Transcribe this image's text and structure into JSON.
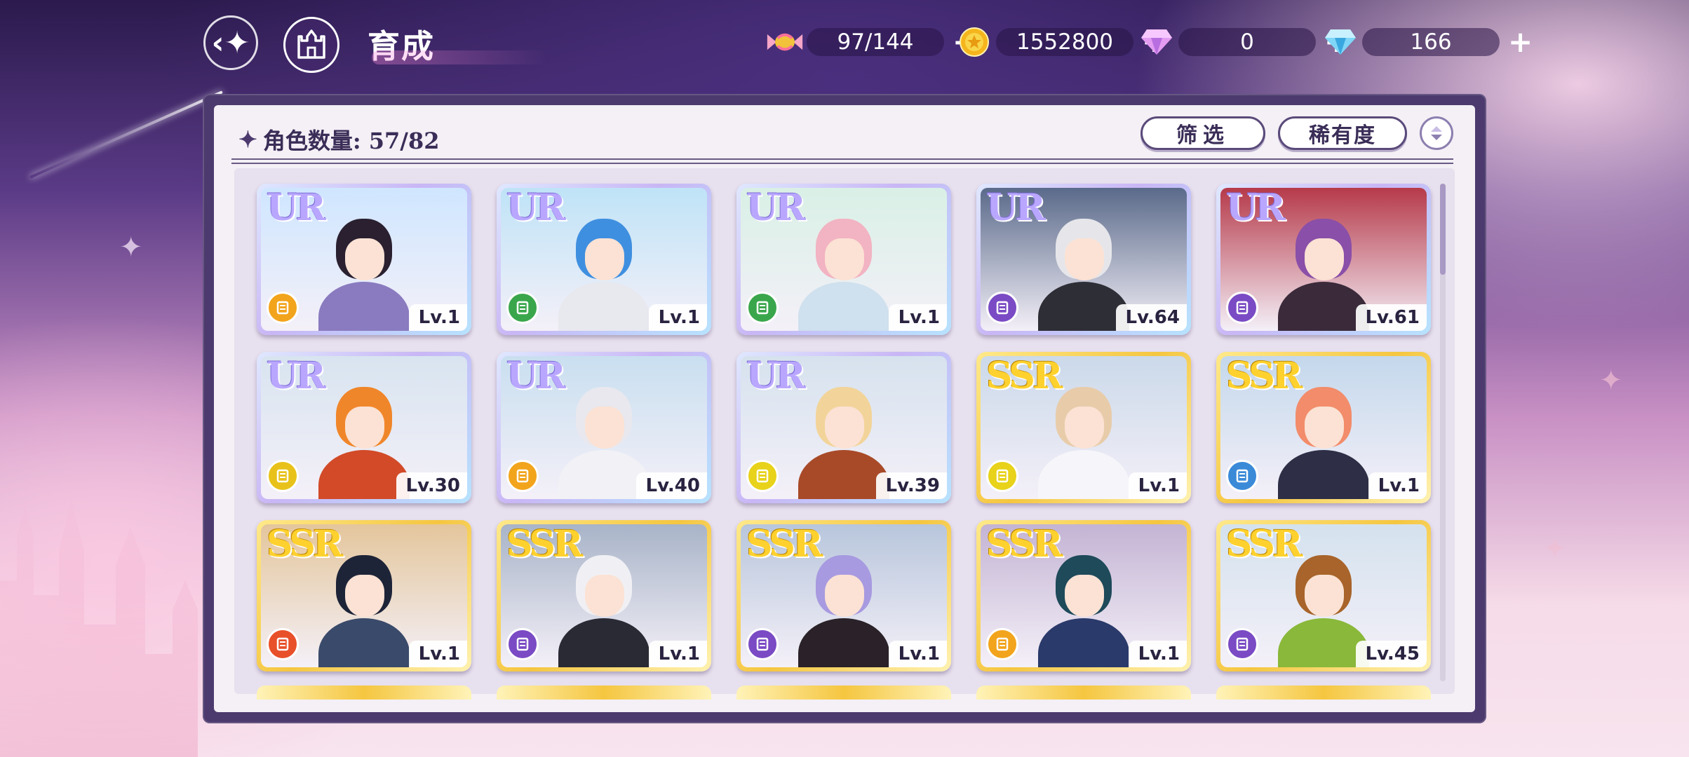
{
  "header": {
    "title": "育成",
    "currencies": [
      {
        "icon": "candy-icon",
        "value": "97/144"
      },
      {
        "icon": "gold-coin-icon",
        "value": "1552800"
      },
      {
        "icon": "pink-gem-icon",
        "value": "0"
      },
      {
        "icon": "blue-diamond-icon",
        "value": "166"
      }
    ]
  },
  "panel": {
    "count_label": "角色数量: 57/82",
    "filter_label": "筛选",
    "sort_label": "稀有度"
  },
  "cards": [
    {
      "rarity": "UR",
      "level": "Lv.1",
      "class_color": "#f2a41c",
      "hair": "#2a2030",
      "outfit": "#8a7bc0",
      "bg": "#cfe6ff"
    },
    {
      "rarity": "UR",
      "level": "Lv.1",
      "class_color": "#3aa64c",
      "hair": "#3f8fe0",
      "outfit": "#e8e8ef",
      "bg": "#bfe3f7"
    },
    {
      "rarity": "UR",
      "level": "Lv.1",
      "class_color": "#3aa64c",
      "hair": "#f2b3c2",
      "outfit": "#cfe0ee",
      "bg": "#d9f0e6"
    },
    {
      "rarity": "UR",
      "level": "Lv.64",
      "class_color": "#7a4bc4",
      "hair": "#e6e6ea",
      "outfit": "#2e2e36",
      "bg": "#5a6a8a"
    },
    {
      "rarity": "UR",
      "level": "Lv.61",
      "class_color": "#7a4bc4",
      "hair": "#8a4fa8",
      "outfit": "#3a2a3a",
      "bg": "#b63a4a"
    },
    {
      "rarity": "UR",
      "level": "Lv.30",
      "class_color": "#e8c21a",
      "hair": "#f0862a",
      "outfit": "#d24a28",
      "bg": "#d8e4f0"
    },
    {
      "rarity": "UR",
      "level": "Lv.40",
      "class_color": "#f2a41c",
      "hair": "#e8e8ee",
      "outfit": "#f2f2f6",
      "bg": "#c9dff0"
    },
    {
      "rarity": "UR",
      "level": "Lv.39",
      "class_color": "#e8d21a",
      "hair": "#f2d49a",
      "outfit": "#a84a28",
      "bg": "#d6e2ee"
    },
    {
      "rarity": "SSR",
      "level": "Lv.1",
      "class_color": "#e8d21a",
      "hair": "#e8ccaa",
      "outfit": "#f6f6fa",
      "bg": "#cbd9ea"
    },
    {
      "rarity": "SSR",
      "level": "Lv.1",
      "class_color": "#3a8ad8",
      "hair": "#f28c6a",
      "outfit": "#2e2e46",
      "bg": "#c4d8ec"
    },
    {
      "rarity": "SSR",
      "level": "Lv.1",
      "class_color": "#e8502a",
      "hair": "#1e2438",
      "outfit": "#3a4a6a",
      "bg": "#e4c69c"
    },
    {
      "rarity": "SSR",
      "level": "Lv.1",
      "class_color": "#7a4bc4",
      "hair": "#f0f0f4",
      "outfit": "#2a2a34",
      "bg": "#a8b4c8"
    },
    {
      "rarity": "SSR",
      "level": "Lv.1",
      "class_color": "#7a4bc4",
      "hair": "#a89ae0",
      "outfit": "#2a2228",
      "bg": "#b8c6dc"
    },
    {
      "rarity": "SSR",
      "level": "Lv.1",
      "class_color": "#f2a41c",
      "hair": "#1e4a5a",
      "outfit": "#2a3a6a",
      "bg": "#c4b4d4"
    },
    {
      "rarity": "SSR",
      "level": "Lv.45",
      "class_color": "#7a4bc4",
      "hair": "#a8642a",
      "outfit": "#8ab83a",
      "bg": "#d4e2ee"
    }
  ]
}
